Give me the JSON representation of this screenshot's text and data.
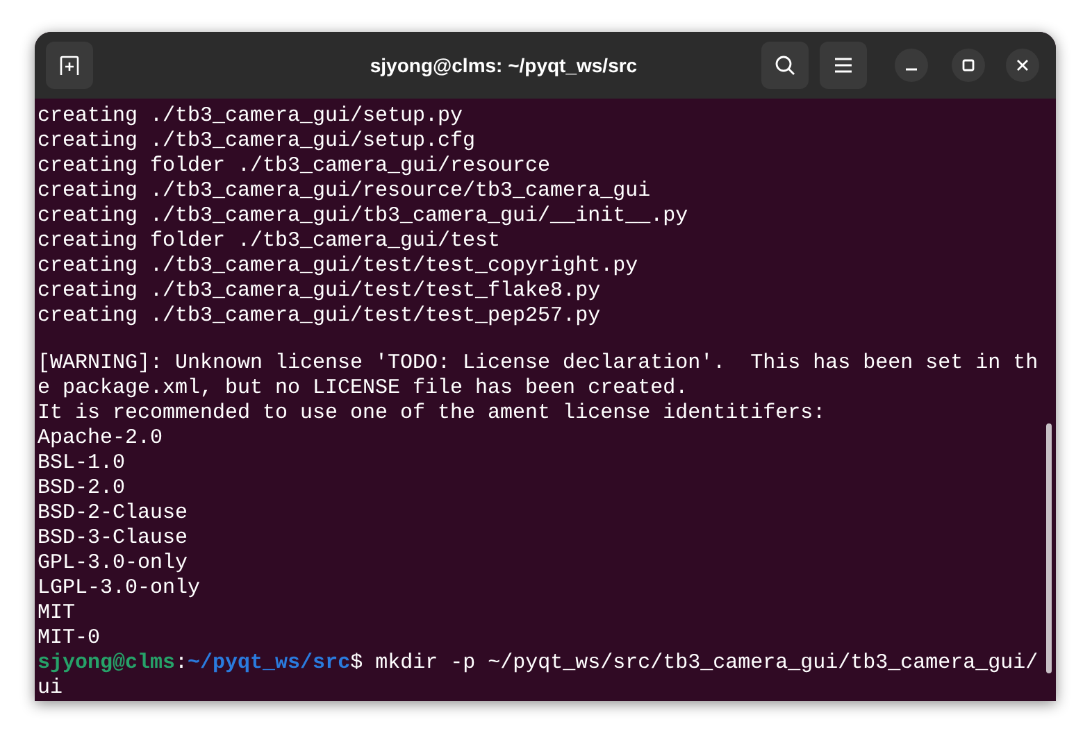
{
  "window": {
    "title": "sjyong@clms: ~/pyqt_ws/src"
  },
  "terminal": {
    "lines": [
      {
        "kind": "output",
        "text": "creating ./tb3_camera_gui/setup.py"
      },
      {
        "kind": "output",
        "text": "creating ./tb3_camera_gui/setup.cfg"
      },
      {
        "kind": "output",
        "text": "creating folder ./tb3_camera_gui/resource"
      },
      {
        "kind": "output",
        "text": "creating ./tb3_camera_gui/resource/tb3_camera_gui"
      },
      {
        "kind": "output",
        "text": "creating ./tb3_camera_gui/tb3_camera_gui/__init__.py"
      },
      {
        "kind": "output",
        "text": "creating folder ./tb3_camera_gui/test"
      },
      {
        "kind": "output",
        "text": "creating ./tb3_camera_gui/test/test_copyright.py"
      },
      {
        "kind": "output",
        "text": "creating ./tb3_camera_gui/test/test_flake8.py"
      },
      {
        "kind": "output",
        "text": "creating ./tb3_camera_gui/test/test_pep257.py"
      },
      {
        "kind": "blank"
      },
      {
        "kind": "output",
        "text": "[WARNING]: Unknown license 'TODO: License declaration'.  This has been set in th"
      },
      {
        "kind": "output",
        "text": "e package.xml, but no LICENSE file has been created."
      },
      {
        "kind": "output",
        "text": "It is recommended to use one of the ament license identitifers:"
      },
      {
        "kind": "output",
        "text": "Apache-2.0"
      },
      {
        "kind": "output",
        "text": "BSL-1.0"
      },
      {
        "kind": "output",
        "text": "BSD-2.0"
      },
      {
        "kind": "output",
        "text": "BSD-2-Clause"
      },
      {
        "kind": "output",
        "text": "BSD-3-Clause"
      },
      {
        "kind": "output",
        "text": "GPL-3.0-only"
      },
      {
        "kind": "output",
        "text": "LGPL-3.0-only"
      },
      {
        "kind": "output",
        "text": "MIT"
      },
      {
        "kind": "output",
        "text": "MIT-0"
      },
      {
        "kind": "prompt",
        "user": "sjyong@clms",
        "separator": ":",
        "path": "~/pyqt_ws/src",
        "command": "$ mkdir -p ~/pyqt_ws/src/tb3_camera_gui/tb3_camera_gui/"
      },
      {
        "kind": "output",
        "text": "ui"
      }
    ]
  }
}
